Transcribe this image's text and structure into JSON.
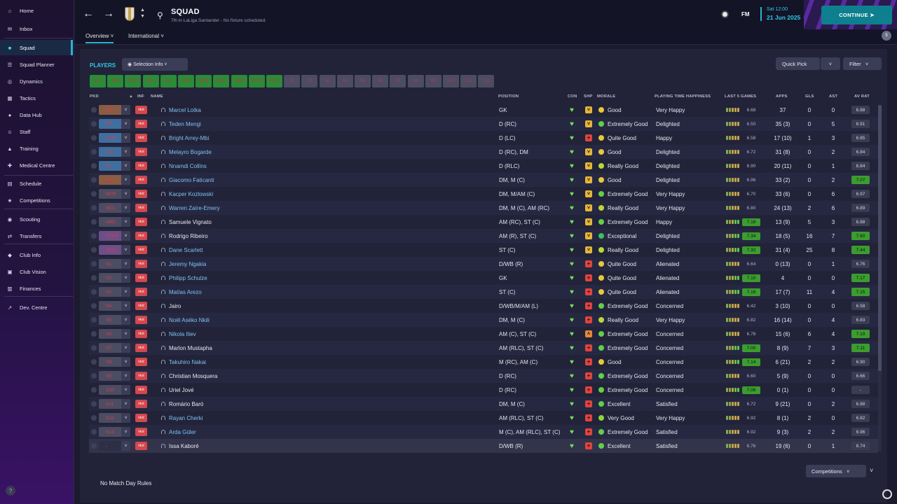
{
  "sidebar": {
    "items": [
      {
        "label": "Home",
        "icon": "home-icon"
      },
      {
        "label": "Inbox",
        "icon": "inbox-icon"
      },
      {
        "label": "Squad",
        "icon": "shirt-icon",
        "active": true
      },
      {
        "label": "Squad Planner",
        "icon": "planner-icon"
      },
      {
        "label": "Dynamics",
        "icon": "dynamics-icon"
      },
      {
        "label": "Tactics",
        "icon": "tactics-icon"
      },
      {
        "label": "Data Hub",
        "icon": "data-hub-icon"
      },
      {
        "label": "Staff",
        "icon": "staff-icon"
      },
      {
        "label": "Training",
        "icon": "training-icon"
      },
      {
        "label": "Medical Centre",
        "icon": "medical-icon"
      },
      {
        "label": "Schedule",
        "icon": "calendar-icon"
      },
      {
        "label": "Competitions",
        "icon": "trophy-icon"
      },
      {
        "label": "Scouting",
        "icon": "scouting-icon"
      },
      {
        "label": "Transfers",
        "icon": "transfers-icon"
      },
      {
        "label": "Club Info",
        "icon": "shield-icon"
      },
      {
        "label": "Club Vision",
        "icon": "vision-icon"
      },
      {
        "label": "Finances",
        "icon": "finances-icon"
      },
      {
        "label": "Dev. Centre",
        "icon": "dev-centre-icon"
      }
    ]
  },
  "header": {
    "title": "SQUAD",
    "subtitle": "7th in LaLiga Santander - No fixture scheduled.",
    "logo": "FM",
    "date_day": "Sat 12:00",
    "date_full": "21 Jun 2025",
    "continue": "CONTINUE",
    "notifications": "5"
  },
  "tabs": [
    "Overview",
    "International"
  ],
  "panel": {
    "players_label": "PLAYERS",
    "selection_info": "Selection Info",
    "quick_pick": "Quick Pick",
    "filter": "Filter",
    "competitions": "Competitions",
    "footer_text": "No Match Day Rules"
  },
  "position_chips": [
    {
      "label": "GK",
      "on": true
    },
    {
      "label": "DR",
      "on": true
    },
    {
      "label": "DCR",
      "on": true
    },
    {
      "label": "DCL",
      "on": true
    },
    {
      "label": "DL",
      "on": true
    },
    {
      "label": "DM",
      "on": true
    },
    {
      "label": "MCR",
      "on": true
    },
    {
      "label": "MCL",
      "on": true
    },
    {
      "label": "AMC",
      "on": true
    },
    {
      "label": "STCR",
      "on": true
    },
    {
      "label": "STCL",
      "on": true
    },
    {
      "label": "S1",
      "on": false
    },
    {
      "label": "S2",
      "on": false
    },
    {
      "label": "S3",
      "on": false
    },
    {
      "label": "S4",
      "on": false
    },
    {
      "label": "S5",
      "on": false
    },
    {
      "label": "S6",
      "on": false
    },
    {
      "label": "S7",
      "on": false
    },
    {
      "label": "S8",
      "on": false
    },
    {
      "label": "S9",
      "on": false
    },
    {
      "label": "S10",
      "on": false
    },
    {
      "label": "S11",
      "on": false
    },
    {
      "label": "S12",
      "on": false
    }
  ],
  "columns": {
    "pkd": "PKD",
    "inf": "INF",
    "name": "NAME",
    "position": "POSITION",
    "con": "CON",
    "shp": "SHP",
    "morale": "MORALE",
    "pth": "PLAYING TIME HAPPINESS",
    "last5": "LAST 5 GAMES",
    "apps": "APPS",
    "gls": "GLS",
    "ast": "AST",
    "avrat": "AV RAT"
  },
  "colors": {
    "accent": "#2ec9ea",
    "green": "#3b9d2f",
    "button": "#0e7f8e"
  },
  "players": [
    {
      "pkd": "GK",
      "pkd_color": "#8a5c44",
      "inf": "Hol",
      "name": "Marcel Lotka",
      "link": true,
      "position": "GK",
      "shp": "yellow",
      "morale": "Good",
      "pth": "Very Happy",
      "last5": "6.68",
      "last5_hi": false,
      "apps": "37",
      "gls": "0",
      "ast": "0",
      "avrat": "6.88",
      "avrat_hi": false
    },
    {
      "pkd": "DR",
      "pkd_color": "#3f6fa0",
      "inf": "Hol",
      "name": "Teden Mengi",
      "link": true,
      "position": "D (RC)",
      "shp": "yellow",
      "morale": "Extremely Good",
      "pth": "Delighted",
      "last5": "6.50",
      "last5_hi": false,
      "apps": "35 (3)",
      "gls": "0",
      "ast": "5",
      "avrat": "6.91",
      "avrat_hi": false
    },
    {
      "pkd": "DCR",
      "pkd_color": "#3f6fa0",
      "inf": "Hol",
      "name": "Bright Arrey-Mbi",
      "link": true,
      "position": "D (LC)",
      "shp": "red",
      "morale": "Quite Good",
      "pth": "Happy",
      "last5": "6.58",
      "last5_hi": false,
      "apps": "17 (10)",
      "gls": "1",
      "ast": "3",
      "avrat": "6.85",
      "avrat_hi": false
    },
    {
      "pkd": "DCL",
      "pkd_color": "#3f6fa0",
      "inf": "Hol",
      "name": "Melayro Bogarde",
      "link": true,
      "position": "D (RC), DM",
      "shp": "yellow",
      "morale": "Good",
      "pth": "Delighted",
      "last5": "6.72",
      "last5_hi": false,
      "apps": "31 (8)",
      "gls": "0",
      "ast": "2",
      "avrat": "6.84",
      "avrat_hi": false
    },
    {
      "pkd": "DL",
      "pkd_color": "#3f6fa0",
      "inf": "Hol",
      "name": "Nnamdi Collins",
      "link": true,
      "position": "D (RLC)",
      "shp": "yellow",
      "morale": "Really Good",
      "pth": "Delighted",
      "last5": "6.90",
      "last5_hi": false,
      "apps": "20 (11)",
      "gls": "0",
      "ast": "1",
      "avrat": "6.84",
      "avrat_hi": false
    },
    {
      "pkd": "DM",
      "pkd_color": "#8a5c44",
      "inf": "Hol",
      "name": "Giacomo Faticanti",
      "link": true,
      "position": "DM, M (C)",
      "shp": "yellow",
      "morale": "Good",
      "pth": "Delighted",
      "last5": "6.96",
      "last5_hi": false,
      "apps": "33 (2)",
      "gls": "0",
      "ast": "2",
      "avrat": "7.07",
      "avrat_hi": true
    },
    {
      "pkd": "MCR",
      "pkd_color": "#4c4d63",
      "inf": "Hol",
      "name": "Kacper Kozlowski",
      "link": true,
      "position": "DM, M/AM (C)",
      "shp": "yellow",
      "morale": "Extremely Good",
      "pth": "Very Happy",
      "last5": "6.70",
      "last5_hi": false,
      "apps": "33 (6)",
      "gls": "0",
      "ast": "6",
      "avrat": "6.97",
      "avrat_hi": false
    },
    {
      "pkd": "MCL",
      "pkd_color": "#4c4d63",
      "inf": "Hol",
      "name": "Warren Zaïre-Emery",
      "link": true,
      "position": "DM, M (C), AM (RC)",
      "shp": "yellow",
      "morale": "Really Good",
      "pth": "Very Happy",
      "last5": "6.80",
      "last5_hi": false,
      "apps": "24 (13)",
      "gls": "2",
      "ast": "6",
      "avrat": "6.89",
      "avrat_hi": false
    },
    {
      "pkd": "AMC",
      "pkd_color": "#4c4d63",
      "inf": "Hol",
      "name": "Samuele Vignato",
      "link": false,
      "position": "AM (RC), ST (C)",
      "shp": "yellow",
      "morale": "Extremely Good",
      "pth": "Happy",
      "last5": "7.18",
      "last5_hi": true,
      "apps": "13 (9)",
      "gls": "5",
      "ast": "3",
      "avrat": "6.88",
      "avrat_hi": false
    },
    {
      "pkd": "STCR",
      "pkd_color": "#6c4f8a",
      "inf": "Hol",
      "name": "Rodrigo Ribeiro",
      "link": false,
      "position": "AM (R), ST (C)",
      "shp": "yellow",
      "morale": "Exceptional",
      "pth": "Delighted",
      "last5": "7.34",
      "last5_hi": true,
      "apps": "18 (5)",
      "gls": "16",
      "ast": "7",
      "avrat": "7.60",
      "avrat_hi": true
    },
    {
      "pkd": "STCL",
      "pkd_color": "#6c4f8a",
      "inf": "Hol",
      "name": "Dane Scarlett",
      "link": true,
      "position": "ST (C)",
      "shp": "yellow",
      "morale": "Really Good",
      "pth": "Delighted",
      "last5": "7.32",
      "last5_hi": true,
      "apps": "31 (4)",
      "gls": "25",
      "ast": "8",
      "avrat": "7.44",
      "avrat_hi": true
    },
    {
      "pkd": "S1",
      "pkd_color": "#4c4d63",
      "inf": "Hol",
      "name": "Jeremy Ngakia",
      "link": true,
      "position": "D/WB (R)",
      "shp": "red",
      "morale": "Quite Good",
      "pth": "Alienated",
      "last5": "6.64",
      "last5_hi": false,
      "apps": "0 (13)",
      "gls": "0",
      "ast": "1",
      "avrat": "6.76",
      "avrat_hi": false
    },
    {
      "pkd": "S2",
      "pkd_color": "#4c4d63",
      "inf": "Hol",
      "name": "Philipp Schulze",
      "link": true,
      "position": "GK",
      "shp": "red",
      "morale": "Quite Good",
      "pth": "Alienated",
      "last5": "7.10",
      "last5_hi": true,
      "apps": "4",
      "gls": "0",
      "ast": "0",
      "avrat": "7.17",
      "avrat_hi": true
    },
    {
      "pkd": "S3",
      "pkd_color": "#4c4d63",
      "inf": "Hol",
      "name": "Matías Arezo",
      "link": true,
      "position": "ST (C)",
      "shp": "red",
      "morale": "Quite Good",
      "pth": "Alienated",
      "last5": "7.16",
      "last5_hi": true,
      "apps": "17 (7)",
      "gls": "11",
      "ast": "4",
      "avrat": "7.15",
      "avrat_hi": true
    },
    {
      "pkd": "S4",
      "pkd_color": "#4c4d63",
      "inf": "Hol",
      "name": "Jairo",
      "link": false,
      "position": "D/WB/M/AM (L)",
      "shp": "red",
      "morale": "Extremely Good",
      "pth": "Concerned",
      "last5": "6.42",
      "last5_hi": false,
      "apps": "3 (10)",
      "gls": "0",
      "ast": "0",
      "avrat": "6.58",
      "avrat_hi": false
    },
    {
      "pkd": "S5",
      "pkd_color": "#4c4d63",
      "inf": "Hol",
      "name": "Noël Aséko Nkili",
      "link": true,
      "position": "DM, M (C)",
      "shp": "red",
      "morale": "Really Good",
      "pth": "Very Happy",
      "last5": "6.82",
      "last5_hi": false,
      "apps": "16 (14)",
      "gls": "0",
      "ast": "4",
      "avrat": "6.83",
      "avrat_hi": false
    },
    {
      "pkd": "S6",
      "pkd_color": "#4c4d63",
      "inf": "Hol",
      "name": "Nikola Iliev",
      "link": true,
      "position": "AM (C), ST (C)",
      "shp": "orange",
      "morale": "Extremely Good",
      "pth": "Concerned",
      "last5": "6.78",
      "last5_hi": false,
      "apps": "15 (6)",
      "gls": "6",
      "ast": "4",
      "avrat": "7.10",
      "avrat_hi": true
    },
    {
      "pkd": "S7",
      "pkd_color": "#4c4d63",
      "inf": "Hol",
      "name": "Marlon Mustapha",
      "link": false,
      "position": "AM (RLC), ST (C)",
      "shp": "red",
      "morale": "Extremely Good",
      "pth": "Concerned",
      "last5": "7.00",
      "last5_hi": true,
      "apps": "8 (9)",
      "gls": "7",
      "ast": "3",
      "avrat": "7.11",
      "avrat_hi": true
    },
    {
      "pkd": "S8",
      "pkd_color": "#4c4d63",
      "inf": "Hol",
      "name": "Takuhiro Nakai",
      "link": true,
      "position": "M (RC), AM (C)",
      "shp": "red",
      "morale": "Good",
      "pth": "Concerned",
      "last5": "7.14",
      "last5_hi": true,
      "apps": "6 (21)",
      "gls": "2",
      "ast": "2",
      "avrat": "6.90",
      "avrat_hi": false
    },
    {
      "pkd": "S9",
      "pkd_color": "#4c4d63",
      "inf": "Hol",
      "name": "Christian Mosquera",
      "link": false,
      "position": "D (RC)",
      "shp": "red",
      "morale": "Extremely Good",
      "pth": "Concerned",
      "last5": "6.60",
      "last5_hi": false,
      "apps": "5 (9)",
      "gls": "0",
      "ast": "0",
      "avrat": "6.66",
      "avrat_hi": false
    },
    {
      "pkd": "S10",
      "pkd_color": "#4c4d63",
      "inf": "Hol",
      "name": "Uriel Jové",
      "link": false,
      "position": "D (RC)",
      "shp": "red",
      "morale": "Extremely Good",
      "pth": "Concerned",
      "last5": "7.08",
      "last5_hi": true,
      "apps": "0 (1)",
      "gls": "0",
      "ast": "0",
      "avrat": "-",
      "avrat_hi": false
    },
    {
      "pkd": "S11",
      "pkd_color": "#4c4d63",
      "inf": "Hol",
      "name": "Romário Baró",
      "link": false,
      "position": "DM, M (C)",
      "shp": "red",
      "morale": "Excellent",
      "pth": "Satisfied",
      "last5": "6.72",
      "last5_hi": false,
      "apps": "9 (21)",
      "gls": "0",
      "ast": "2",
      "avrat": "6.88",
      "avrat_hi": false
    },
    {
      "pkd": "S12",
      "pkd_color": "#4c4d63",
      "inf": "Hol",
      "name": "Rayan Cherki",
      "link": true,
      "position": "AM (RLC), ST (C)",
      "shp": "red",
      "morale": "Very Good",
      "pth": "Very Happy",
      "last5": "6.92",
      "last5_hi": false,
      "apps": "8 (1)",
      "gls": "2",
      "ast": "0",
      "avrat": "6.82",
      "avrat_hi": false
    },
    {
      "pkd": "S13",
      "pkd_color": "#4c4d63",
      "inf": "Hol",
      "name": "Arda Güler",
      "link": true,
      "position": "M (C), AM (RLC), ST (C)",
      "shp": "red",
      "morale": "Extremely Good",
      "pth": "Satisfied",
      "last5": "6.92",
      "last5_hi": false,
      "apps": "9 (3)",
      "gls": "2",
      "ast": "2",
      "avrat": "6.96",
      "avrat_hi": false
    },
    {
      "pkd": "-",
      "pkd_color": "#2d2f46",
      "inf": "Hol",
      "name": "Issa Kaboré",
      "link": false,
      "position": "D/WB (R)",
      "shp": "red",
      "morale": "Excellent",
      "pth": "Satisfied",
      "last5": "6.76",
      "last5_hi": false,
      "apps": "19 (6)",
      "gls": "0",
      "ast": "1",
      "avrat": "6.74",
      "avrat_hi": false,
      "selected": true
    }
  ]
}
